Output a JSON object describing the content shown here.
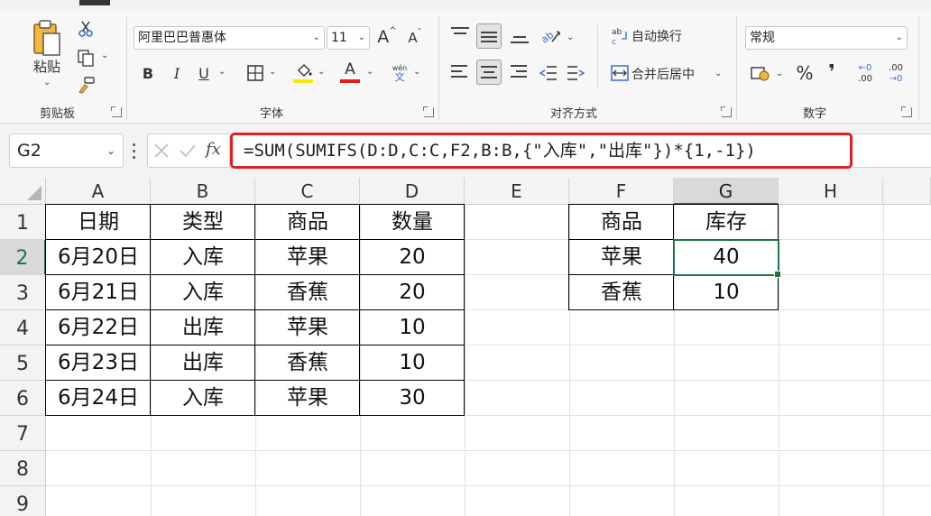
{
  "ribbon": {
    "clipboard": {
      "paste_label": "粘贴",
      "group_label": "剪贴板"
    },
    "font": {
      "font_name": "阿里巴巴普惠体",
      "font_size": "11",
      "bold": "B",
      "italic": "I",
      "underline": "U",
      "font_color_letter": "A",
      "grow_label": "A",
      "shrink_label": "A",
      "phonetic_top": "wén",
      "phonetic_bottom": "文",
      "group_label": "字体"
    },
    "alignment": {
      "wrap_text": "自动换行",
      "merge_center": "合并后居中",
      "group_label": "对齐方式"
    },
    "number": {
      "format": "常规",
      "percent": "%",
      "comma": "❜",
      "inc_decimal_top": "←0",
      "inc_decimal_bottom": ".00",
      "dec_decimal_top": ".00",
      "dec_decimal_bottom": "→0",
      "group_label": "数字"
    },
    "colors": {
      "font_color": "#e21b1b",
      "fill_color": "#ffe600"
    }
  },
  "formula_bar": {
    "name_box": "G2",
    "fx": "fx",
    "formula": "=SUM(SUMIFS(D:D,C:C,F2,B:B,{\"入库\",\"出库\"})*{1,-1})"
  },
  "sheet": {
    "columns": [
      "A",
      "B",
      "C",
      "D",
      "E",
      "F",
      "G",
      "H"
    ],
    "rows": [
      "1",
      "2",
      "3",
      "4",
      "5",
      "6",
      "7",
      "8",
      "9"
    ],
    "active_column": "G",
    "active_row": "2",
    "table1": {
      "headers": [
        "日期",
        "类型",
        "商品",
        "数量"
      ],
      "rows": [
        [
          "6月20日",
          "入库",
          "苹果",
          "20"
        ],
        [
          "6月21日",
          "入库",
          "香蕉",
          "20"
        ],
        [
          "6月22日",
          "出库",
          "苹果",
          "10"
        ],
        [
          "6月23日",
          "出库",
          "香蕉",
          "10"
        ],
        [
          "6月24日",
          "入库",
          "苹果",
          "30"
        ]
      ]
    },
    "table2": {
      "headers": [
        "商品",
        "库存"
      ],
      "rows": [
        [
          "苹果",
          "40"
        ],
        [
          "香蕉",
          "10"
        ]
      ]
    }
  }
}
